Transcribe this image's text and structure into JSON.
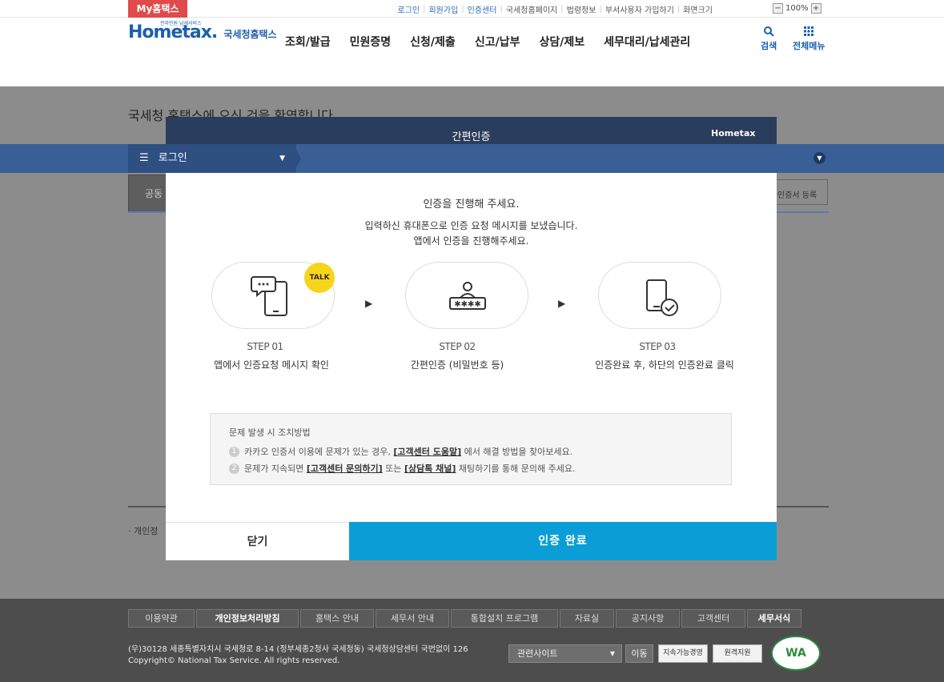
{
  "topbar": {
    "my_tax": "My홈택스",
    "links": [
      "로그인",
      "회원가입",
      "인증센터",
      "국세청홈페이지",
      "법령정보",
      "부서사용자 가입하기",
      "화면크기"
    ],
    "zoom": "100%",
    "zoom_minus": "−",
    "zoom_plus": "+"
  },
  "header": {
    "logo_text": "Hometax.",
    "logo_sub": "국세청홈택스",
    "logo_tiny": "전자민원 납세서비스",
    "nav": [
      "조회/발급",
      "민원증명",
      "신청/제출",
      "신고/납부",
      "상담/제보",
      "세무대리/납세관리"
    ],
    "search_label": "검색",
    "menu_label": "전체메뉴"
  },
  "background_page": {
    "welcome": "국세청 홈택스에 오신 것을 환영합니다",
    "login_label": "로그인",
    "tab_label": "공동",
    "cert_button": "인증서 등록",
    "note": "· 개인정"
  },
  "modal": {
    "title": "간편인증",
    "header_logo": "Hometax",
    "heading": "인증을 진행해 주세요.",
    "desc1": "입력하신 휴대폰으로 인증 요청 메시지를 보냈습니다.",
    "desc2": "앱에서 인증을 진행해주세요.",
    "talk_badge": "TALK",
    "steps": [
      {
        "label": "STEP 01",
        "desc": "앱에서 인증요청 메시지 확인",
        "icon": "phone-chat-icon"
      },
      {
        "label": "STEP 02",
        "desc": "간편인증 (비밀번호 등)",
        "icon": "user-password-icon"
      },
      {
        "label": "STEP 03",
        "desc": "인증완료 후, 하단의 인증완료 클릭",
        "icon": "phone-check-icon"
      }
    ],
    "tips_title": "문제 발생 시 조치방법",
    "tip1_num": "1",
    "tip1_pre": "카카오 인증서 이용에 문제가 있는 경우,",
    "tip1_link": "[고객센터 도움말]",
    "tip1_post": "에서 해결 방법을 찾아보세요.",
    "tip2_num": "2",
    "tip2_pre": "문제가 지속되면",
    "tip2_link1": "[고객센터 문의하기]",
    "tip2_mid": "또는",
    "tip2_link2": "[상담톡 채널]",
    "tip2_post": "채팅하기를 통해 문의해 주세요.",
    "close_button": "닫기",
    "done_button": "인증 완료"
  },
  "footer": {
    "nav": [
      "이용약관",
      "개인정보처리방침",
      "홈택스 안내",
      "세무서 안내",
      "통합설치 프로그램",
      "자료실",
      "공지사항",
      "고객센터",
      "세무서식"
    ],
    "address": "(우)30128 세종특별자치시 국세청로 8-14 (정부세종2청사 국세청동) 국세청상담센터 국번없이 126",
    "copyright": "Copyright© National Tax Service. All rights reserved.",
    "related_select": "관련사이트",
    "move_button": "이동",
    "badge1": "지속가능경영",
    "badge2": "원격지원",
    "wa_mark": "WA"
  }
}
